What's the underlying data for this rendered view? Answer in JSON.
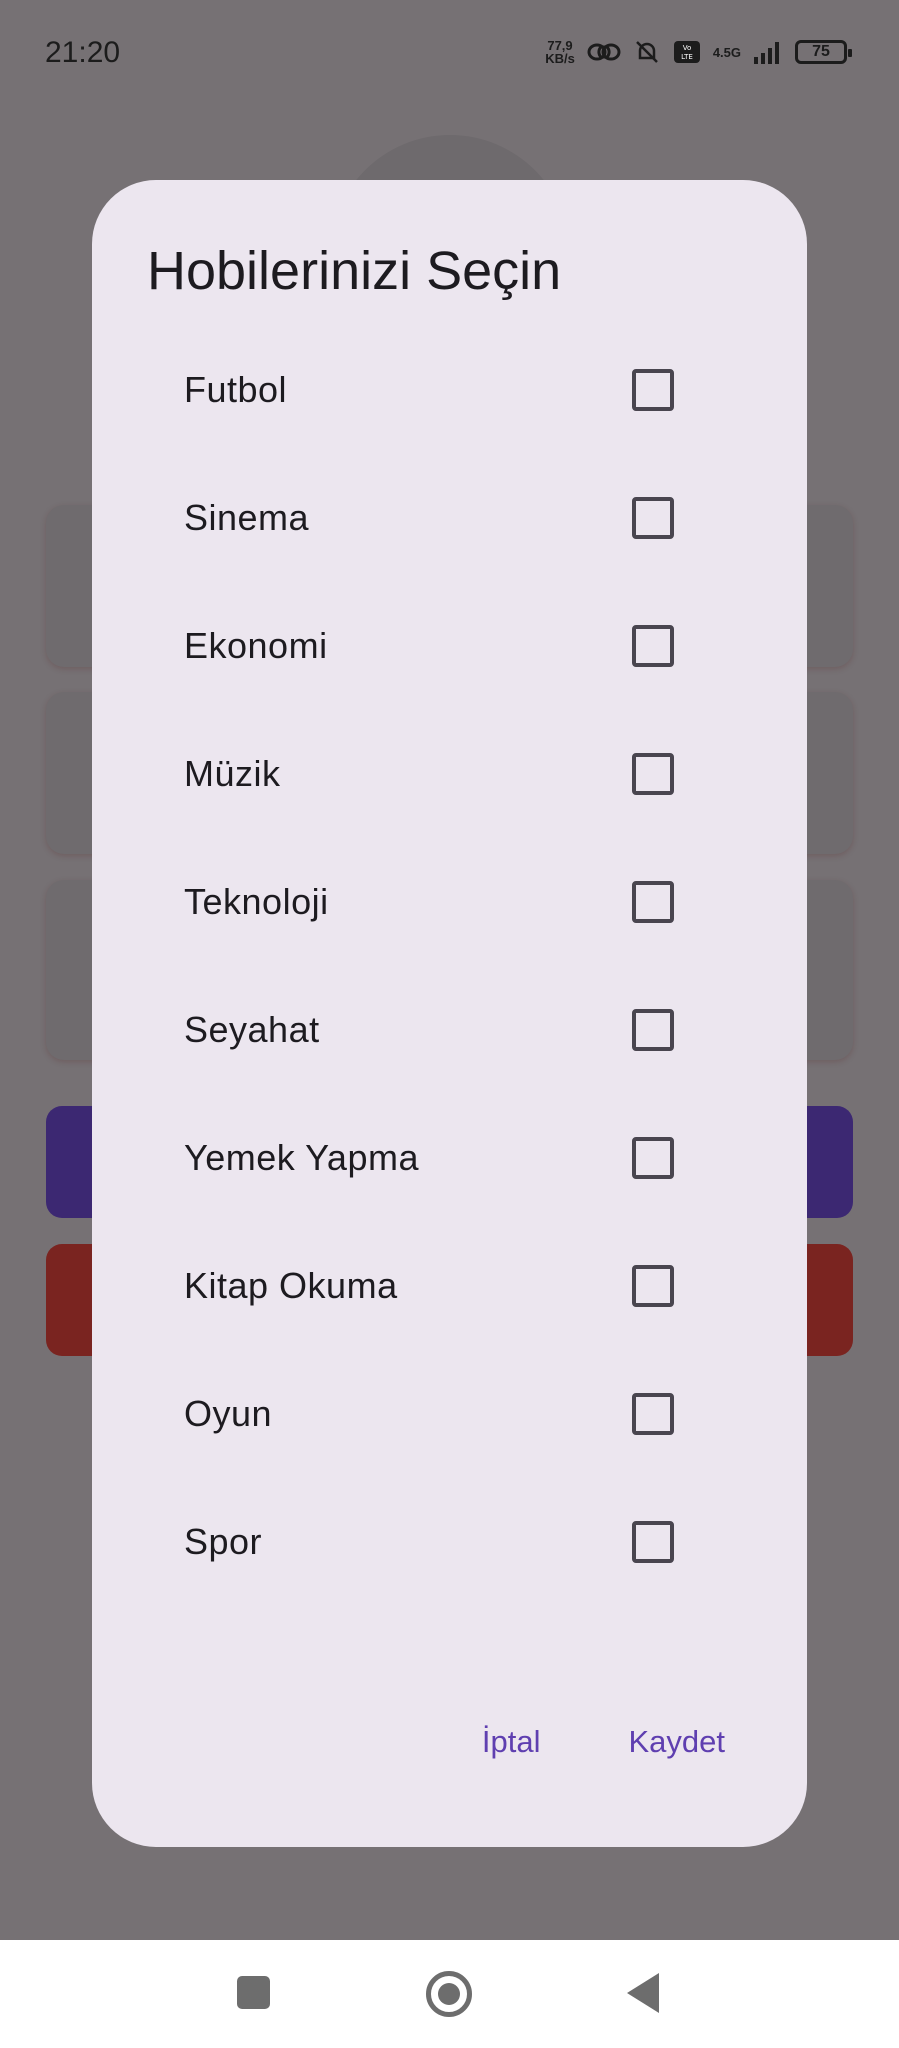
{
  "status_bar": {
    "time": "21:20",
    "net_speed_value": "77,9",
    "net_speed_unit": "KB/s",
    "volte": "Vo LTE",
    "network": "4.5G",
    "battery": "75"
  },
  "dialog": {
    "title": "Hobilerinizi Seçin",
    "hobbies": [
      {
        "label": "Futbol",
        "checked": false
      },
      {
        "label": "Sinema",
        "checked": false
      },
      {
        "label": "Ekonomi",
        "checked": false
      },
      {
        "label": "Müzik",
        "checked": false
      },
      {
        "label": "Teknoloji",
        "checked": false
      },
      {
        "label": "Seyahat",
        "checked": false
      },
      {
        "label": "Yemek Yapma",
        "checked": false
      },
      {
        "label": "Kitap Okuma",
        "checked": false
      },
      {
        "label": "Oyun",
        "checked": false
      },
      {
        "label": "Spor",
        "checked": false
      }
    ],
    "cancel_label": "İptal",
    "save_label": "Kaydet"
  },
  "colors": {
    "scrim": "#767174",
    "dialog_bg": "#ece6ef",
    "accent": "#5f3fb0",
    "bg_purple_button": "#3c2872",
    "bg_red_button": "#7a2420"
  },
  "nav_bar": {
    "icons": [
      "recents-square-icon",
      "home-circle-icon",
      "back-triangle-icon"
    ]
  }
}
